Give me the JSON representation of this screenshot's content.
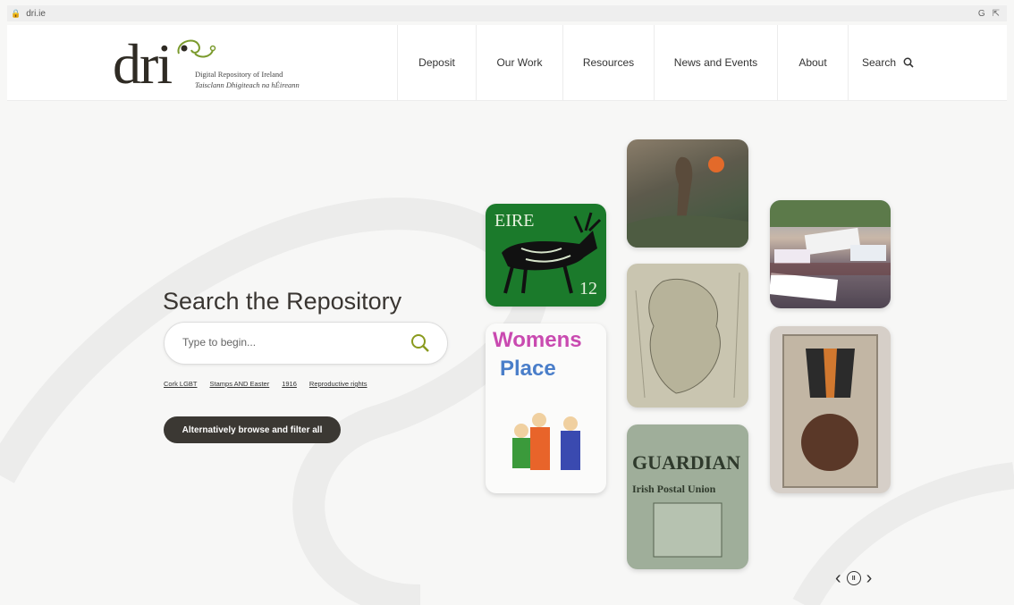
{
  "browser": {
    "url": "dri.ie",
    "ext_icons": [
      "G",
      "share-icon"
    ]
  },
  "logo": {
    "wordmark": "dri",
    "tagline_en": "Digital Repository of Ireland",
    "tagline_ga": "Taisclann Dhigiteach na hÉireann"
  },
  "nav": {
    "items": [
      "Deposit",
      "Our Work",
      "Resources",
      "News and Events",
      "About"
    ],
    "search_label": "Search"
  },
  "hero": {
    "title": "Search the Repository",
    "search_placeholder": "Type to begin...",
    "quick_links": [
      "Cork LGBT",
      "Stamps AND Easter",
      "1916",
      "Reproductive rights"
    ],
    "browse_button": "Alternatively browse and filter all"
  },
  "tiles": {
    "stamp": {
      "country": "EIRE",
      "value": "12"
    },
    "women": {
      "line1": "Womens",
      "line2": "Place"
    },
    "guardian": {
      "line1": "GUARDIAN",
      "line2": "Irish Postal Union"
    }
  },
  "colors": {
    "accent": "#3b3833",
    "stamp_green": "#1b7a2b",
    "logo_green": "#7a9a2c"
  }
}
